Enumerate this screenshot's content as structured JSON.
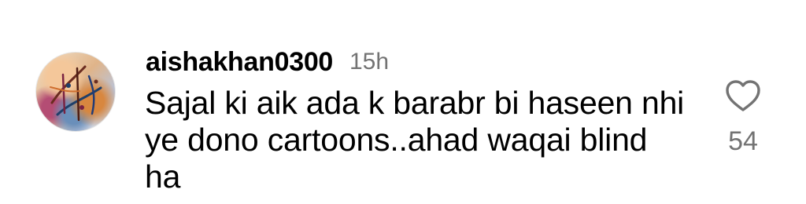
{
  "comment": {
    "avatar_icon": "profile-avatar-calligraphy-art",
    "username": "aishakhan0300",
    "timestamp": "15h",
    "text": "Sajal ki aik ada k barabr bi haseen nhi ye dono cartoons..ahad waqai blind ha",
    "like_icon": "heart-outline-icon",
    "like_count": "54"
  },
  "colors": {
    "text_primary": "#000000",
    "text_secondary": "#737373",
    "background": "#ffffff"
  }
}
